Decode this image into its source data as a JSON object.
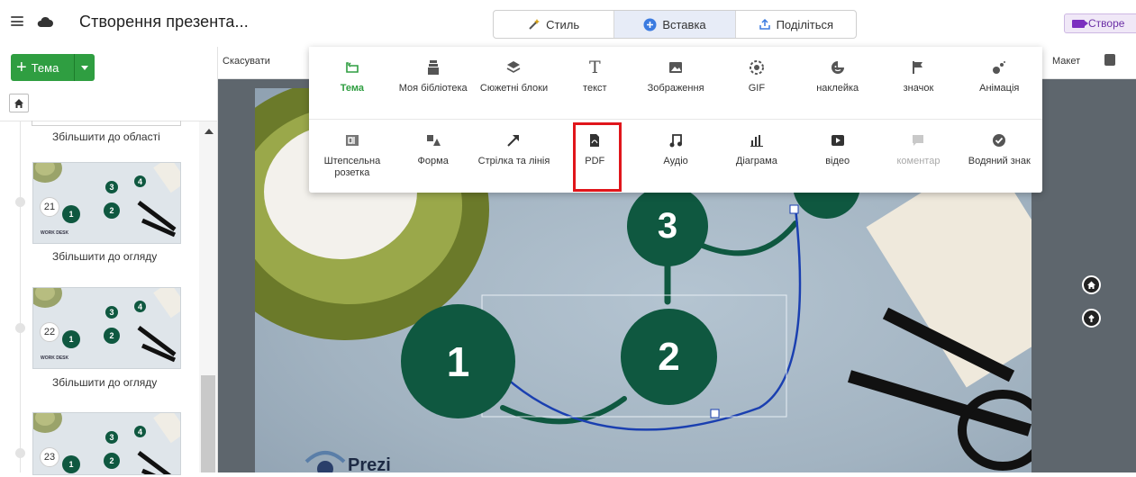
{
  "app": {
    "title": "Створення презента...",
    "tabs": [
      {
        "label": "Стиль",
        "icon": "magic-wand-icon"
      },
      {
        "label": "Вставка",
        "icon": "plus-circle-icon"
      },
      {
        "label": "Поділіться",
        "icon": "share-icon"
      }
    ],
    "active_tab": "Вставка",
    "create_button": "Створе"
  },
  "sidebar": {
    "theme_button": "Тема",
    "slides": [
      {
        "label": "Збільшити до області"
      },
      {
        "number": "21",
        "label": "Збільшити до огляду"
      },
      {
        "number": "22",
        "label": "Збільшити до огляду"
      },
      {
        "number": "23"
      }
    ]
  },
  "toolbar": {
    "cancel": "Скасувати",
    "layout": "Макет"
  },
  "insert_menu": {
    "row1": [
      {
        "label": "Тема",
        "icon": "theme-icon",
        "active": true
      },
      {
        "label": "Моя бібліотека",
        "icon": "library-icon"
      },
      {
        "label": "Сюжетні блоки",
        "icon": "layers-icon"
      },
      {
        "label": "текст",
        "icon": "text-icon"
      },
      {
        "label": "Зображення",
        "icon": "image-icon"
      },
      {
        "label": "GIF",
        "icon": "gif-icon"
      },
      {
        "label": "наклейка",
        "icon": "sticker-icon"
      },
      {
        "label": "значок",
        "icon": "flag-icon"
      },
      {
        "label": "Анімація",
        "icon": "animation-icon"
      }
    ],
    "row2": [
      {
        "label": "Штепсельна розетка",
        "icon": "plugin-icon"
      },
      {
        "label": "Форма",
        "icon": "shape-icon"
      },
      {
        "label": "Стрілка та лінія",
        "icon": "arrow-icon"
      },
      {
        "label": "PDF",
        "icon": "pdf-icon",
        "highlighted": true
      },
      {
        "label": "Аудіо",
        "icon": "music-icon"
      },
      {
        "label": "Діаграма",
        "icon": "chart-icon"
      },
      {
        "label": "відео",
        "icon": "video-icon"
      },
      {
        "label": "коментар",
        "icon": "comment-icon",
        "disabled": true
      },
      {
        "label": "Водяний знак",
        "icon": "watermark-icon"
      }
    ]
  },
  "slide": {
    "nodes": [
      "1",
      "2",
      "3"
    ],
    "logo": "Prezi",
    "thumb_logo": "WORK DESK"
  },
  "colors": {
    "accent_green": "#2f9e41",
    "node_green": "#0f5840",
    "highlight_red": "#e0161b",
    "path_blue": "#1a3fb0"
  }
}
